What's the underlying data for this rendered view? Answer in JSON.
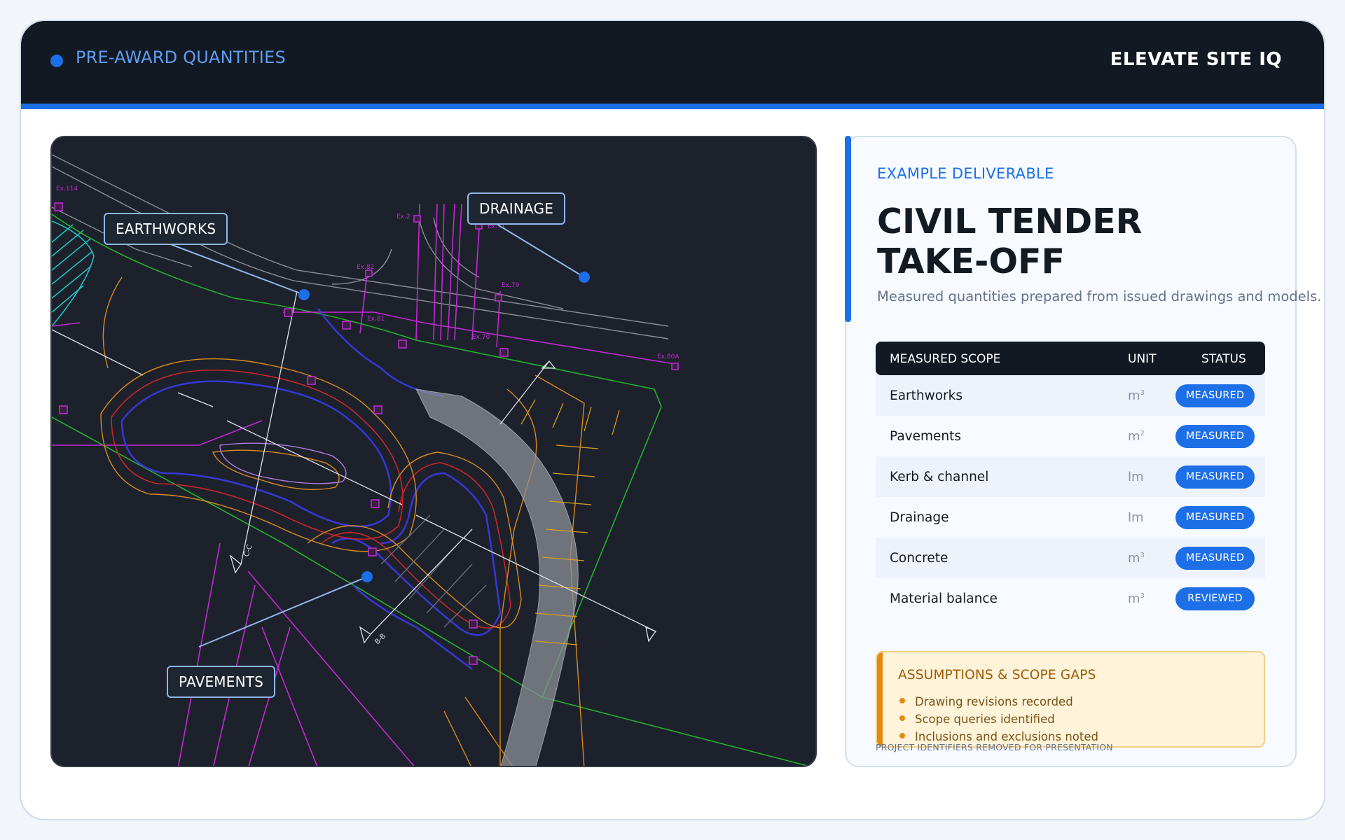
{
  "header": {
    "section_label": "PRE-AWARD QUANTITIES",
    "brand": "ELEVATE SITE IQ"
  },
  "drawing": {
    "callouts": {
      "earthworks": "EARTHWORKS",
      "drainage": "DRAINAGE",
      "pavements": "PAVEMENTS"
    },
    "pit_labels": [
      "Ex.114",
      "Ex.2",
      "Ex.71",
      "Ex.82",
      "Ex.81",
      "Ex.70",
      "Ex.79",
      "Ex.80A"
    ],
    "section_markers": [
      "C-C",
      "B-B"
    ]
  },
  "deliverable": {
    "eyebrow": "EXAMPLE DELIVERABLE",
    "title_line1": "CIVIL TENDER",
    "title_line2": "TAKE-OFF",
    "subtitle": "Measured quantities prepared from issued drawings and models."
  },
  "scope_table": {
    "headers": {
      "scope": "MEASURED SCOPE",
      "unit": "UNIT",
      "status": "STATUS"
    },
    "rows": [
      {
        "scope": "Earthworks",
        "unit": "m",
        "unit_power": "3",
        "status": "MEASURED"
      },
      {
        "scope": "Pavements",
        "unit": "m",
        "unit_power": "2",
        "status": "MEASURED"
      },
      {
        "scope": "Kerb & channel",
        "unit": "lm",
        "unit_power": "",
        "status": "MEASURED"
      },
      {
        "scope": "Drainage",
        "unit": "lm",
        "unit_power": "",
        "status": "MEASURED"
      },
      {
        "scope": "Concrete",
        "unit": "m",
        "unit_power": "3",
        "status": "MEASURED"
      },
      {
        "scope": "Material balance",
        "unit": "m",
        "unit_power": "3",
        "status": "REVIEWED"
      }
    ]
  },
  "assumptions": {
    "title": "ASSUMPTIONS & SCOPE GAPS",
    "items": [
      "Drawing revisions recorded",
      "Scope queries identified",
      "Inclusions and exclusions noted"
    ]
  },
  "footnote": "PROJECT IDENTIFIERS REMOVED FOR PRESENTATION",
  "colors": {
    "accent": "#1d6fe8",
    "header_bg": "#121923",
    "cad_bg": "#1d212b",
    "warning_accent": "#e18a12"
  }
}
